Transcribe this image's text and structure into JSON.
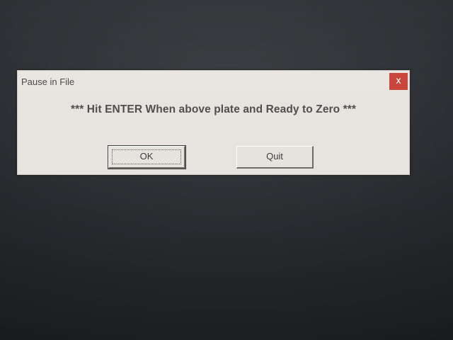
{
  "dialog": {
    "title": "Pause in File",
    "close_label": "x",
    "message": "*** Hit ENTER When above plate and Ready to Zero ***",
    "buttons": {
      "ok_label": "OK",
      "quit_label": "Quit"
    }
  },
  "colors": {
    "close_button": "#c9463c",
    "dialog_background": "#e7e3de",
    "desktop_background": "#2a2d31"
  },
  "icons": {
    "close": "close-icon"
  }
}
